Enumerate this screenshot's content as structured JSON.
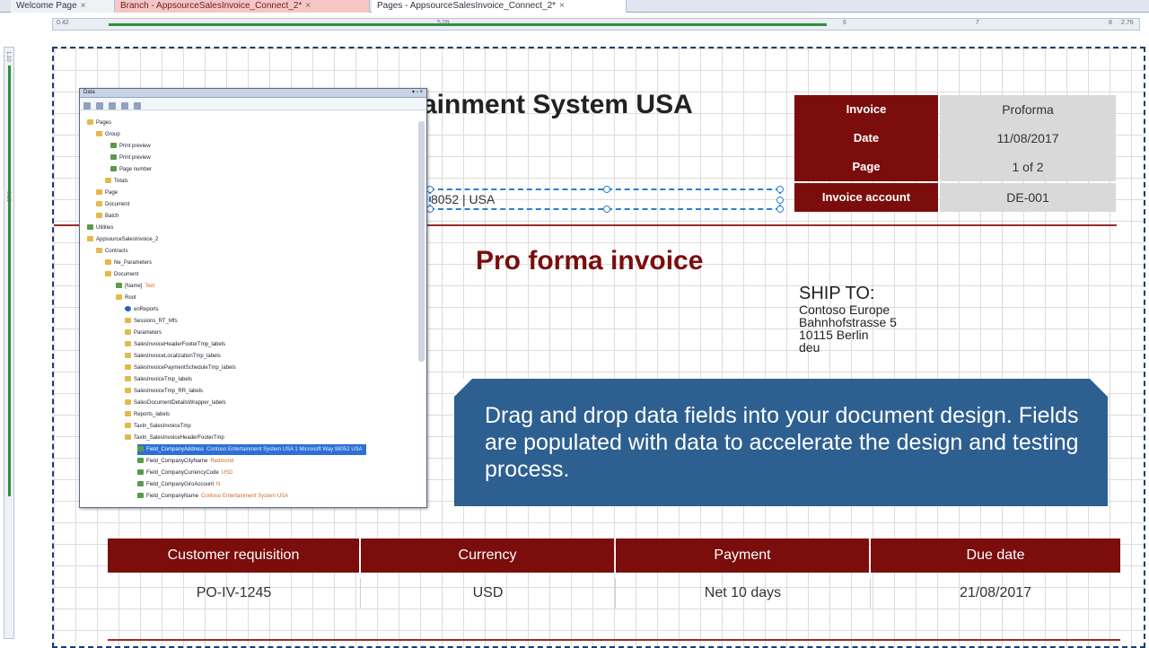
{
  "tabs": [
    {
      "label": "Welcome Page"
    },
    {
      "label": "Branch - AppsourceSalesInvoice_Connect_2*"
    },
    {
      "label": "Pages - AppsourceSalesInvoice_Connect_2*"
    }
  ],
  "ruler": {
    "h_ticks": [
      "0.42",
      "5.09",
      "6",
      "7",
      "8",
      "2.76"
    ],
    "v_ticks": [
      "1.10",
      "0.13"
    ]
  },
  "document": {
    "company_name": "ainment System USA",
    "address_fragment": "8052 | USA",
    "info_rows": [
      {
        "label": "Invoice",
        "value": "Proforma"
      },
      {
        "label": "Date",
        "value": "11/08/2017"
      },
      {
        "label": "Page",
        "value": "1 of 2"
      },
      {
        "label": "Invoice account",
        "value": "DE-001"
      }
    ],
    "title": "Pro forma invoice",
    "ship_to": {
      "heading": "SHIP TO:",
      "lines": [
        "Contoso Europe",
        "Bahnhofstrasse 5",
        "10115 Berlin",
        "deu"
      ]
    },
    "callout": "Drag and drop data fields into your document design. Fields are populated with data to accelerate the design and testing process.",
    "table": {
      "headers": [
        "Customer requisition",
        "Currency",
        "Payment",
        "Due date"
      ],
      "values": [
        "PO-IV-1245",
        "USD",
        "Net 10 days",
        "21/08/2017"
      ]
    }
  },
  "panel": {
    "title": "Data",
    "nodes": [
      {
        "label": "Pages",
        "ann": ""
      },
      {
        "label": "Group",
        "ann": ""
      },
      {
        "label": "Print preview",
        "ann": ""
      },
      {
        "label": "Print preview",
        "ann": ""
      },
      {
        "label": "Page number",
        "ann": ""
      },
      {
        "label": "Totals",
        "ann": ""
      },
      {
        "label": "Page",
        "ann": ""
      },
      {
        "label": "Document",
        "ann": ""
      },
      {
        "label": "Batch",
        "ann": ""
      },
      {
        "label": "Utilities",
        "ann": ""
      },
      {
        "label": "AppsourceSalesInvoice_2",
        "ann": ""
      },
      {
        "label": "Contracts",
        "ann": ""
      },
      {
        "label": "Ne_Parameters",
        "ann": ""
      },
      {
        "label": "Document",
        "ann": ""
      },
      {
        "label": "[Name]",
        "ann": "Text"
      },
      {
        "label": "Root",
        "ann": ""
      },
      {
        "label": "enReports",
        "ann": ""
      },
      {
        "label": "Sessions_RT_Mfs",
        "ann": ""
      },
      {
        "label": "Parameters",
        "ann": ""
      },
      {
        "label": "SalesInvoiceHeaderFooterTmp_labels",
        "ann": ""
      },
      {
        "label": "SalesInvoiceLocalizationTmp_labels",
        "ann": ""
      },
      {
        "label": "SalesInvoicePaymentScheduleTmp_labels",
        "ann": ""
      },
      {
        "label": "SalesInvoiceTmp_labels",
        "ann": ""
      },
      {
        "label": "SalesInvoiceTmp_RR_labels",
        "ann": ""
      },
      {
        "label": "SalesDocumentDetailsWrapper_labels",
        "ann": ""
      },
      {
        "label": "Reports_labels",
        "ann": ""
      },
      {
        "label": "TaxIn_SalesInvoiceTmp",
        "ann": ""
      },
      {
        "label": "TaxIn_SalesInvoiceHeaderFooterTmp",
        "ann": ""
      },
      {
        "label": "Field_CompanyAddress",
        "ann": "Contoso Entertainment System USA 1 Microsoft Way 98052 USA"
      },
      {
        "label": "Field_CompanyCityName",
        "ann": "Redmond"
      },
      {
        "label": "Field_CompanyCurrencyCode",
        "ann": "USD"
      },
      {
        "label": "Field_CompanyGiroAccount",
        "ann": "N"
      },
      {
        "label": "Field_CompanyName",
        "ann": "Contoso Entertainment System USA"
      }
    ]
  }
}
